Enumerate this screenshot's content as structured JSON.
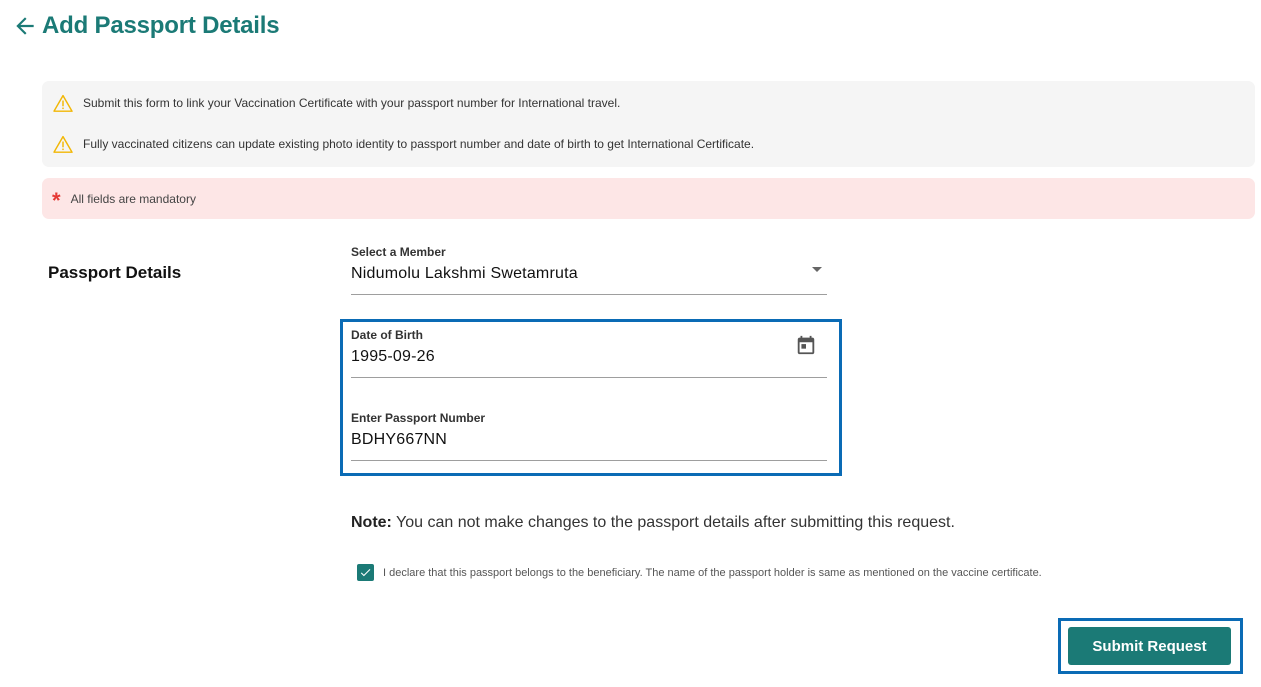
{
  "header": {
    "title": "Add Passport Details",
    "back_icon": "arrow-left-icon"
  },
  "info": {
    "messages": [
      "Submit this form to link your Vaccination Certificate with your passport number for International travel.",
      "Fully vaccinated citizens can update existing photo identity to passport number and date of birth to get International Certificate."
    ],
    "icon": "warning-icon",
    "icon_color": "#f2b705"
  },
  "mandatory": {
    "symbol": "*",
    "text": "All fields are mandatory",
    "color": "#e53935"
  },
  "form": {
    "section_label": "Passport Details",
    "member": {
      "label": "Select a Member",
      "value": "Nidumolu Lakshmi Swetamruta"
    },
    "dob": {
      "label": "Date of Birth",
      "value": "1995-09-26",
      "icon": "calendar-icon"
    },
    "passport": {
      "label": "Enter Passport Number",
      "value": "BDHY667NN"
    }
  },
  "note": {
    "prefix": "Note:",
    "text": " You can not make changes to the passport details after submitting this request."
  },
  "declaration": {
    "checked": true,
    "text": "I declare that this passport belongs to the beneficiary. The name of the passport holder is same as mentioned on the vaccine certificate."
  },
  "submit": {
    "label": "Submit Request"
  },
  "colors": {
    "brand": "#1b7a76",
    "highlight": "#0a6bb5"
  }
}
